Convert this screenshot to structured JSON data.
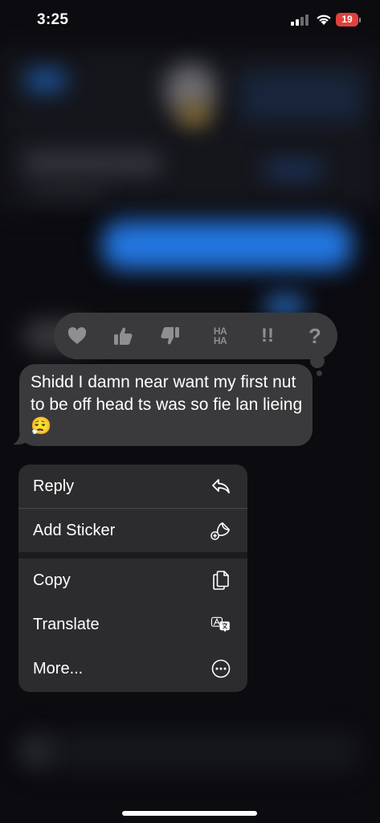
{
  "status_bar": {
    "time": "3:25",
    "battery_level": "19",
    "battery_color": "#e0413c"
  },
  "tapback": {
    "reactions": [
      {
        "name": "heart",
        "icon": "heart-icon"
      },
      {
        "name": "like",
        "icon": "thumbs-up-icon"
      },
      {
        "name": "dislike",
        "icon": "thumbs-down-icon"
      },
      {
        "name": "laugh",
        "label": "HA HA",
        "label_line1": "HA",
        "label_line2": "HA"
      },
      {
        "name": "emphasize",
        "label": "!!"
      },
      {
        "name": "question",
        "label": "?"
      }
    ]
  },
  "message": {
    "text": "Shidd I damn near want my first nut to be off head ts was so fie lan lieing 😮‍💨"
  },
  "context_menu": {
    "items": [
      {
        "label": "Reply",
        "icon": "reply-arrow-icon"
      },
      {
        "label": "Add Sticker",
        "icon": "add-sticker-icon"
      },
      {
        "label": "Copy",
        "icon": "copy-icon"
      },
      {
        "label": "Translate",
        "icon": "translate-icon"
      },
      {
        "label": "More...",
        "icon": "more-ellipsis-icon"
      }
    ]
  },
  "colors": {
    "bubble": "#3a3a3c",
    "menu": "#2c2c2e",
    "tapback_icon": "#8e8e93"
  }
}
